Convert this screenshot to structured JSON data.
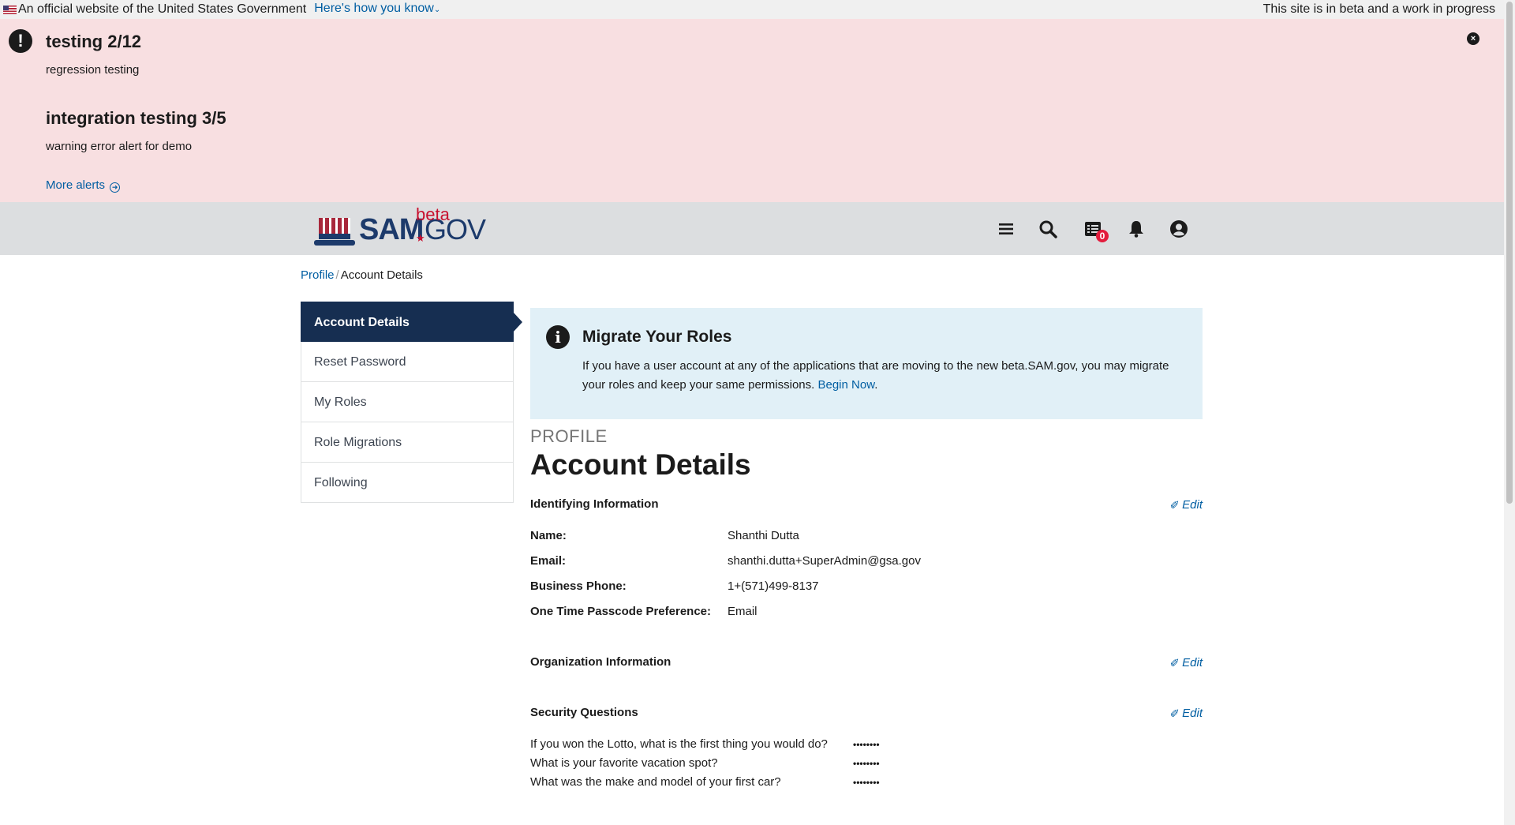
{
  "gov_banner": {
    "official_text": "An official website of the United States Government",
    "how_link": "Here's how you know",
    "beta_notice": "This site is in beta and a work in progress"
  },
  "alerts": {
    "items": [
      {
        "title": "testing 2/12",
        "body": "regression testing"
      },
      {
        "title": "integration testing 3/5",
        "body": "warning error alert for demo"
      }
    ],
    "more_alerts": "More alerts",
    "close_symbol": "×"
  },
  "header": {
    "logo": {
      "sam": "SAM",
      "gov": "GOV",
      "beta": "beta"
    },
    "icons": [
      "menu-icon",
      "search-icon",
      "messages-icon",
      "notifications-icon",
      "account-icon"
    ],
    "messages_count": "0"
  },
  "breadcrumb": {
    "parent": "Profile",
    "separator": "/",
    "current": "Account Details"
  },
  "sidenav": {
    "items": [
      {
        "label": "Account Details",
        "active": true
      },
      {
        "label": "Reset Password"
      },
      {
        "label": "My Roles"
      },
      {
        "label": "Role Migrations"
      },
      {
        "label": "Following"
      }
    ]
  },
  "migrate": {
    "title": "Migrate Your Roles",
    "text": "If you have a user account at any of the applications that are moving to the new beta.SAM.gov, you may migrate your roles and keep your same permissions.",
    "link": "Begin Now",
    "suffix": "."
  },
  "page": {
    "eyebrow": "PROFILE",
    "title": "Account Details"
  },
  "identifying": {
    "title": "Identifying Information",
    "edit": "Edit",
    "fields": [
      {
        "label": "Name:",
        "value": "Shanthi Dutta"
      },
      {
        "label": "Email:",
        "value": "shanthi.dutta+SuperAdmin@gsa.gov"
      },
      {
        "label": "Business Phone:",
        "value": "1+(571)499-8137"
      },
      {
        "label": "One Time Passcode Preference:",
        "value": "Email"
      }
    ]
  },
  "organization": {
    "title": "Organization Information",
    "edit": "Edit"
  },
  "security": {
    "title": "Security Questions",
    "edit": "Edit",
    "questions": [
      {
        "q": "If you won the Lotto, what is the first thing you would do?",
        "a": "••••••••"
      },
      {
        "q": "What is your favorite vacation spot?",
        "a": "••••••••"
      },
      {
        "q": "What was the make and model of your first car?",
        "a": "••••••••"
      }
    ]
  },
  "colors": {
    "alert_bg": "#f8dfe1",
    "header_bg": "#dcdee0",
    "nav_active": "#162e51",
    "info_bg": "#e1f0f7",
    "link": "#005ea2",
    "badge": "#e31c3d"
  }
}
